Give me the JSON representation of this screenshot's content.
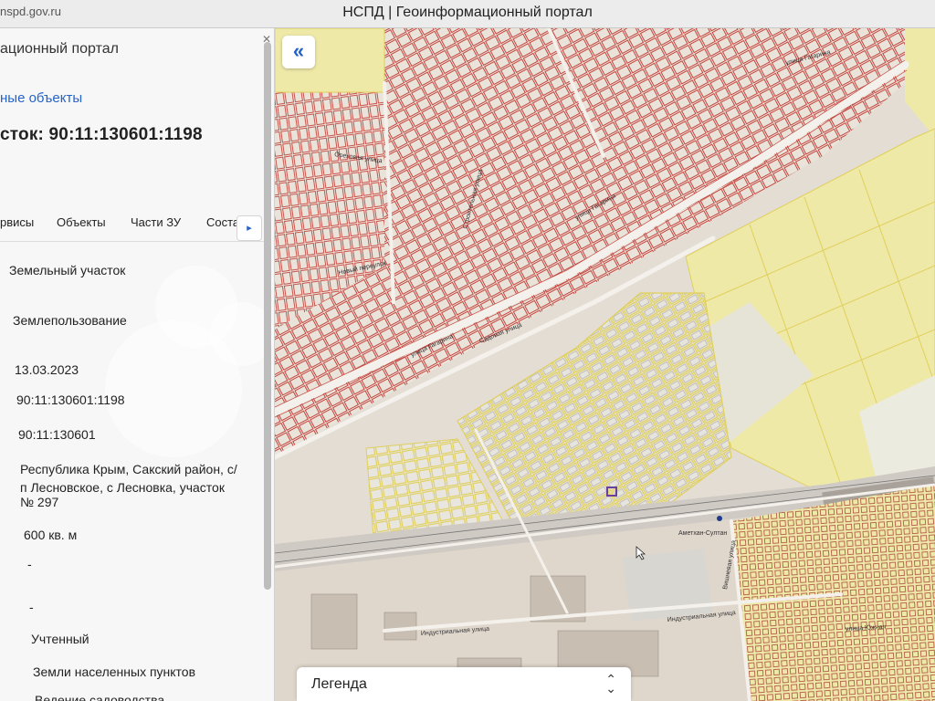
{
  "browser": {
    "url": "nspd.gov.ru",
    "window_title": "НСПД | Геоинформационный портал"
  },
  "panel": {
    "portal_title": "ационный портал",
    "objects_link": "ные объекты",
    "parcel_title": "сток: 90:11:130601:1198",
    "tabs": [
      "рвисы",
      "Объекты",
      "Части ЗУ",
      "Соста"
    ],
    "tab_next": "▸",
    "fields": {
      "object_type": "Земельный участок",
      "kind": "Землепользование",
      "date": "13.03.2023",
      "cadastral_number": "90:11:130601:1198",
      "quarter": "90:11:130601",
      "address_line1": "Республика Крым, Сакский район, с/",
      "address_line2": "п Лесновское, с Лесновка, участок",
      "address_line3": "№ 297",
      "area": "600 кв. м",
      "dash1": "-",
      "dash2": "-",
      "status": "Учтенный",
      "category": "Земли населенных пунктов",
      "use": "Ведение садоводства"
    }
  },
  "map": {
    "collapse_icon": "«",
    "legend_title": "Легенда",
    "legend_chevron_up": "⌃",
    "legend_chevron_down": "⌄",
    "streets": {
      "gagarina": "улица Гагарина",
      "gagarina2": "улица Гагарина",
      "gagarina3": "улица Гагарина",
      "orekhovaya": "Ореховая улица",
      "novy": "Новый переулок",
      "sadovaya": "Садовая улица",
      "stroitelnaya": "Строительная улица",
      "industrialnaya": "Индустриальная улица",
      "industrialnaya2": "Индустриальная улица",
      "amet": "Аметхан-Султан",
      "vishnevaya": "Вишневая улица",
      "yuzhnaya": "улица Южная"
    },
    "colors": {
      "parcel_red": "#c4463f",
      "parcel_yellow": "#e8d86a",
      "field_yellow": "#efe9a8",
      "selected": "#6b3fa0"
    }
  }
}
